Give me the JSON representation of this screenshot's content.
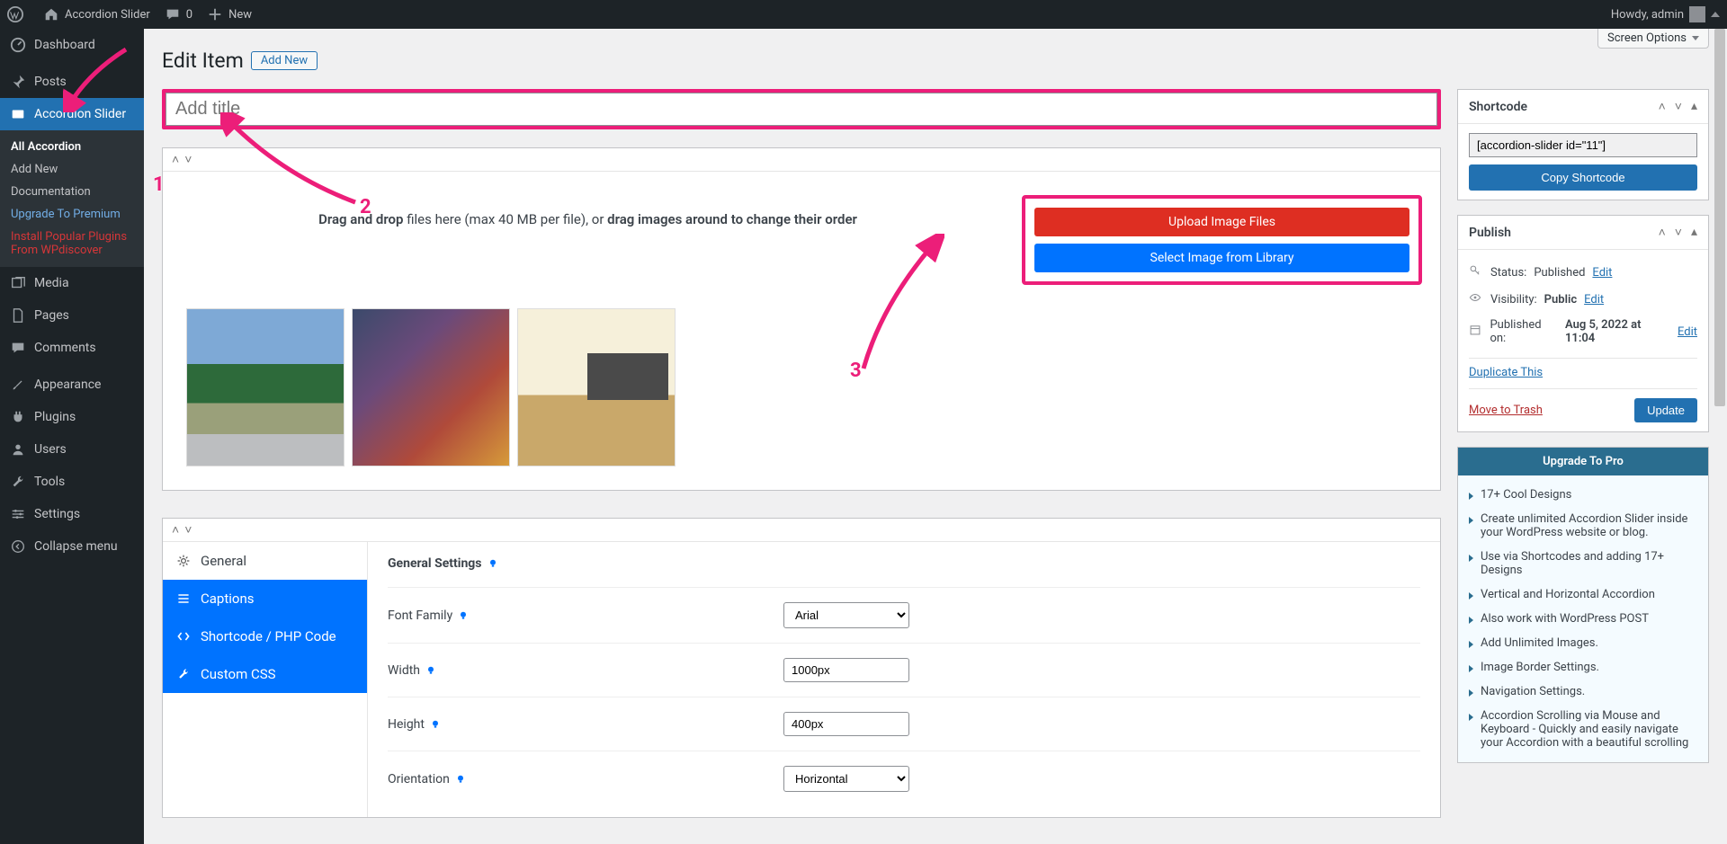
{
  "adminbar": {
    "site_name": "Accordion Slider",
    "comments_count": "0",
    "new_label": "New",
    "howdy": "Howdy, admin"
  },
  "adminmenu": {
    "dashboard": "Dashboard",
    "posts": "Posts",
    "accordion_slider": "Accordion Slider",
    "submenu": {
      "all": "All Accordion",
      "add_new": "Add New",
      "documentation": "Documentation",
      "upgrade": "Upgrade To Premium",
      "install_popular": "Install Popular Plugins From WPdiscover"
    },
    "media": "Media",
    "pages": "Pages",
    "comments": "Comments",
    "appearance": "Appearance",
    "plugins": "Plugins",
    "users": "Users",
    "tools": "Tools",
    "settings": "Settings",
    "collapse": "Collapse menu"
  },
  "screen_options": "Screen Options",
  "heading": {
    "title": "Edit Item",
    "add_new": "Add New"
  },
  "title_placeholder": "Add title",
  "upload": {
    "drop_text_1": "Drag and drop",
    "drop_text_2": " files here (max 40 MB per file), or ",
    "drop_text_3": "drag images around to change their order",
    "upload_btn": "Upload Image Files",
    "library_btn": "Select Image from Library"
  },
  "settings": {
    "tabs": {
      "general": "General",
      "captions": "Captions",
      "shortcode": "Shortcode / PHP Code",
      "custom_css": "Custom CSS"
    },
    "heading": "General Settings",
    "rows": {
      "font_family": {
        "label": "Font Family",
        "value": "Arial"
      },
      "width": {
        "label": "Width",
        "value": "1000px"
      },
      "height": {
        "label": "Height",
        "value": "400px"
      },
      "orientation": {
        "label": "Orientation",
        "value": "Horizontal"
      }
    }
  },
  "shortcode_box": {
    "title": "Shortcode",
    "value": "[accordion-slider id=\"11\"]",
    "copy": "Copy Shortcode"
  },
  "publish_box": {
    "title": "Publish",
    "status_label": "Status:",
    "status_value": "Published",
    "visibility_label": "Visibility:",
    "visibility_value": "Public",
    "published_label": "Published on:",
    "published_value": "Aug 5, 2022 at 11:04",
    "edit": "Edit",
    "duplicate": "Duplicate This",
    "trash": "Move to Trash",
    "update": "Update"
  },
  "upgrade_box": {
    "title": "Upgrade To Pro",
    "items": [
      "17+ Cool Designs",
      "Create unlimited Accordion Slider inside your WordPress website or blog.",
      "Use via Shortcodes and adding 17+ Designs",
      "Vertical and Horizontal Accordion",
      "Also work with WordPress POST",
      "Add Unlimited Images.",
      "Image Border Settings.",
      "Navigation Settings.",
      "Accordion Scrolling via Mouse and Keyboard - Quickly and easily navigate your Accordion with a beautiful scrolling"
    ]
  },
  "annotations": {
    "n1": "1",
    "n2": "2",
    "n3": "3"
  }
}
